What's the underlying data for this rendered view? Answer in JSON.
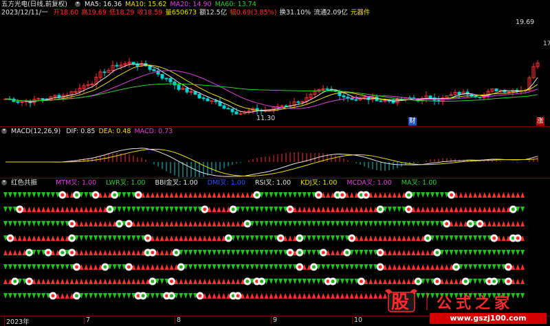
{
  "header": {
    "stock": "五方光电(日线,前复权)",
    "ma_items": [
      {
        "text": "MA5: 16.36",
        "color": "#e6e6e6"
      },
      {
        "text": "MA10: 15.62",
        "color": "#f0e000"
      },
      {
        "text": "MA20: 14.90",
        "color": "#e040e0"
      },
      {
        "text": "MA60: 13.74",
        "color": "#30d030"
      }
    ]
  },
  "info": {
    "date": "2023/12/11/一",
    "items": [
      {
        "text": "开18.60",
        "color": "#ff3030"
      },
      {
        "text": "高19.69",
        "color": "#ff3030"
      },
      {
        "text": "低18.29",
        "color": "#ff3030"
      },
      {
        "text": "收18.59",
        "color": "#ff3030"
      },
      {
        "text": "量650673",
        "color": "#f0e000"
      },
      {
        "text": "额12.5亿",
        "color": "#e6e6e6"
      },
      {
        "text": "幅0.69(3.85%)",
        "color": "#ff3030"
      },
      {
        "text": "换31.10%",
        "color": "#e6e6e6"
      },
      {
        "text": "流通2.09亿",
        "color": "#e6e6e6"
      },
      {
        "text": "元器件",
        "color": "#f0e000"
      }
    ]
  },
  "price_chart": {
    "high_label": "19.69",
    "high_label_short": "17",
    "low_label": "11.30",
    "right_axis": "17",
    "badge_cai": "财",
    "badge_zhang": "涨"
  },
  "macd": {
    "title": "MACD(12,26,9)",
    "items": [
      {
        "text": "DIF: 0.85",
        "color": "#e6e6e6"
      },
      {
        "text": "DEA: 0.48",
        "color": "#f0e000"
      },
      {
        "text": "MACD: 0.73",
        "color": "#e040e0"
      }
    ]
  },
  "resonance": {
    "title": "红色共振",
    "items": [
      {
        "text": "MTM叉: 1.00",
        "color": "#e040e0"
      },
      {
        "text": "LWR叉: 1.00",
        "color": "#30d030"
      },
      {
        "text": "BBI金叉: 1.00",
        "color": "#e6e6e6"
      },
      {
        "text": "DMI叉: 1.00",
        "color": "#3050ff"
      },
      {
        "text": "RSI叉: 1.00",
        "color": "#e6e6e6"
      },
      {
        "text": "KDJ叉: 1.00",
        "color": "#f0e000"
      },
      {
        "text": "MCDA叉: 1.00",
        "color": "#e040e0"
      },
      {
        "text": "MA叉: 1.00",
        "color": "#30d030"
      }
    ]
  },
  "axis": {
    "labels": [
      "2023年",
      "7",
      "8",
      "9",
      "10"
    ]
  },
  "logo": {
    "stock": "股",
    "name": "公式之家",
    "url": "www.gszj100.com"
  },
  "colors": {
    "up": "#ff3232",
    "down": "#00d0d0",
    "ma5": "#e6e6e6",
    "ma10": "#f0e000",
    "ma20": "#e040e0",
    "ma60": "#30d030"
  }
}
